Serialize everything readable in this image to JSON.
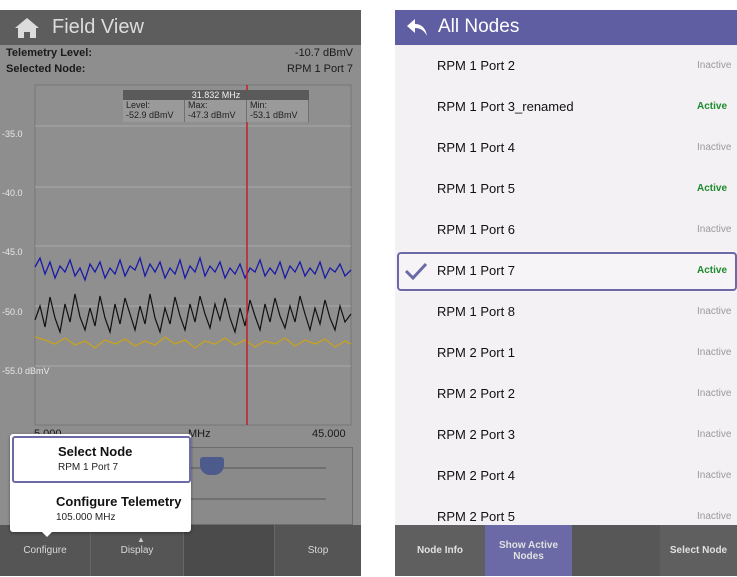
{
  "left": {
    "title": "Field View",
    "telemetry_label": "Telemetry Level:",
    "telemetry_value": "-10.7 dBmV",
    "node_label": "Selected Node:",
    "node_value": "RPM 1 Port 7",
    "marker": {
      "freq": "31.832 MHz",
      "level_label": "Level:",
      "level_value": "-52.9 dBmV",
      "max_label": "Max:",
      "max_value": "-47.3 dBmV",
      "min_label": "Min:",
      "min_value": "-53.1 dBmV"
    },
    "y_ticks": [
      "-35.0",
      "-40.0",
      "-45.0",
      "-50.0",
      "-55.0 dBmV"
    ],
    "x_left": "5.000",
    "x_mid": "MHz",
    "x_right": "45.000",
    "popup": {
      "item1_title": "Select Node",
      "item1_sub": "RPM 1 Port 7",
      "item2_title": "Configure Telemetry",
      "item2_sub": "105.000 MHz"
    },
    "footer": [
      "Configure",
      "Display",
      "",
      "Stop"
    ]
  },
  "right": {
    "title": "All Nodes",
    "nodes": [
      {
        "name": "RPM 1 Port 2",
        "status": "Inactive"
      },
      {
        "name": "RPM 1 Port 3_renamed",
        "status": "Active"
      },
      {
        "name": "RPM 1 Port 4",
        "status": "Inactive"
      },
      {
        "name": "RPM 1 Port 5",
        "status": "Active"
      },
      {
        "name": "RPM 1 Port 6",
        "status": "Inactive"
      },
      {
        "name": "RPM 1 Port 7",
        "status": "Active"
      },
      {
        "name": "RPM 1 Port 8",
        "status": "Inactive"
      },
      {
        "name": "RPM 2 Port 1",
        "status": "Inactive"
      },
      {
        "name": "RPM 2 Port 2",
        "status": "Inactive"
      },
      {
        "name": "RPM 2 Port 3",
        "status": "Inactive"
      },
      {
        "name": "RPM 2 Port 4",
        "status": "Inactive"
      },
      {
        "name": "RPM 2 Port 5",
        "status": "Inactive"
      }
    ],
    "footer": {
      "node_info": "Node Info",
      "show_active_line1": "Show Active",
      "show_active_line2": "Nodes",
      "select_node": "Select Node"
    }
  },
  "colors": {
    "accent": "#5f5ea3",
    "active_green": "#1d8b2d",
    "trace_blue": "#1a1aa8",
    "trace_black": "#111111",
    "trace_yellow": "#c8a21e",
    "marker_red": "#c0202a"
  }
}
